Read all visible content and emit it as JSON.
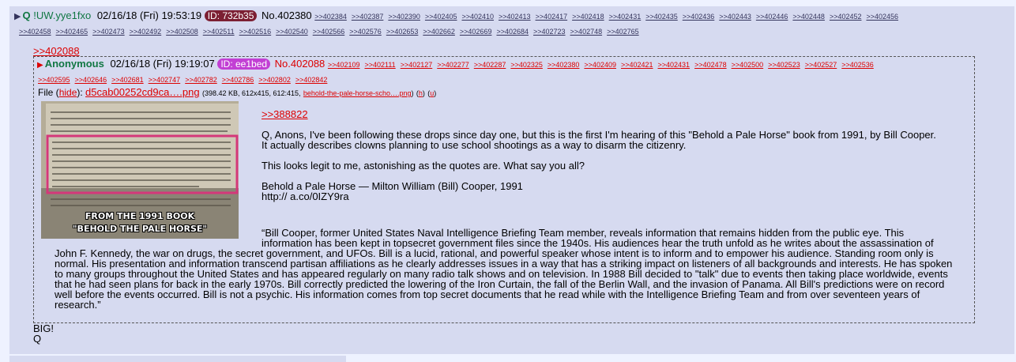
{
  "outer_post": {
    "name": "Q",
    "trip": "!UW.yye1fxo",
    "date": "02/16/18 (Fri) 19:53:19",
    "id_label": "ID: 732b35",
    "id_color": "#7c1f33",
    "post_number": "No.402380",
    "replies_row1": [
      ">>402384",
      ">>402387",
      ">>402390",
      ">>402405",
      ">>402410",
      ">>402413",
      ">>402417",
      ">>402418",
      ">>402431",
      ">>402435",
      ">>402436",
      ">>402443",
      ">>402446",
      ">>402448",
      ">>402452",
      ">>402456"
    ],
    "replies_row2": [
      ">>402458",
      ">>402465",
      ">>402473",
      ">>402492",
      ">>402508",
      ">>402511",
      ">>402516",
      ">>402540",
      ">>402566",
      ">>402576",
      ">>402653",
      ">>402662",
      ">>402669",
      ">>402684",
      ">>402723",
      ">>402748",
      ">>402765"
    ],
    "quote_link": ">>402088",
    "footer_lines": [
      "BIG!",
      "Q"
    ]
  },
  "inner_post": {
    "name": "Anonymous",
    "date": "02/16/18 (Fri) 19:19:07",
    "id_label": "ID: ee1bed",
    "id_color": "#c23fd4",
    "post_number": "No.402088",
    "replies_row1": [
      ">>402109",
      ">>402111",
      ">>402127",
      ">>402277",
      ">>402287",
      ">>402325",
      ">>402380",
      ">>402409",
      ">>402421",
      ">>402431",
      ">>402478",
      ">>402500",
      ">>402523",
      ">>402527",
      ">>402536"
    ],
    "replies_row2": [
      ">>402595",
      ">>402646",
      ">>402681",
      ">>402747",
      ">>402782",
      ">>402786",
      ">>402802",
      ">>402842"
    ],
    "file": {
      "label": "File",
      "hide": "hide",
      "filename": "d5cab00252cd9ca….png",
      "meta": "(398.42 KB, 612x415, 612:415,",
      "original": "behold-the-pale-horse-scho….png",
      "h": "h",
      "u": "u",
      "thumb_caption_1": "FROM THE 1991 BOOK",
      "thumb_caption_2": "\"BEHOLD THE PALE HORSE\""
    },
    "body": {
      "quote": ">>388822",
      "p1": "Q, Anons, I've been following these drops since day one, but this is the first I'm hearing of this \"Behold a Pale Horse\" book from 1991, by Bill Cooper. It actually describes clowns planning to use school shootings as a way to disarm the citizenry.",
      "p2": "This looks legit to me, astonishing as the quotes are. What say you all?",
      "p3a": "Behold a Pale Horse — Milton William (Bill) Cooper, 1991",
      "p3b": "http://  a.co/0IZY9ra",
      "long_first": "“Bill Cooper, former United States Naval Intelligence Briefing Team member, reveals information that remains hidden from the public eye. This information has been kept in topsecret government files since the 1940s. His audiences hear the truth unfold as he writes about the assassination of",
      "long_rest": "John F. Kennedy, the war on drugs, the secret government, and UFOs. Bill is a lucid, rational, and powerful speaker whose intent is to inform and to empower his audience. Standing room only is normal. His presentation and information transcend partisan affiliations as he clearly addresses issues in a way that has a striking impact on listeners of all backgrounds and interests. He has spoken to many groups throughout the United States and has appeared regularly on many radio talk shows and on television. In 1988 Bill decided to \"talk\" due to events then taking place worldwide, events that he had seen plans for back in the early 1970s. Bill correctly predicted the lowering of the Iron Curtain, the fall of the Berlin Wall, and the invasion of Panama. All Bill's predictions were on record well before the events occurred. Bill is not a psychic. His information comes from top secret documents that he read while with the Intelligence Briefing Team and from over seventeen years of research.”"
    }
  }
}
